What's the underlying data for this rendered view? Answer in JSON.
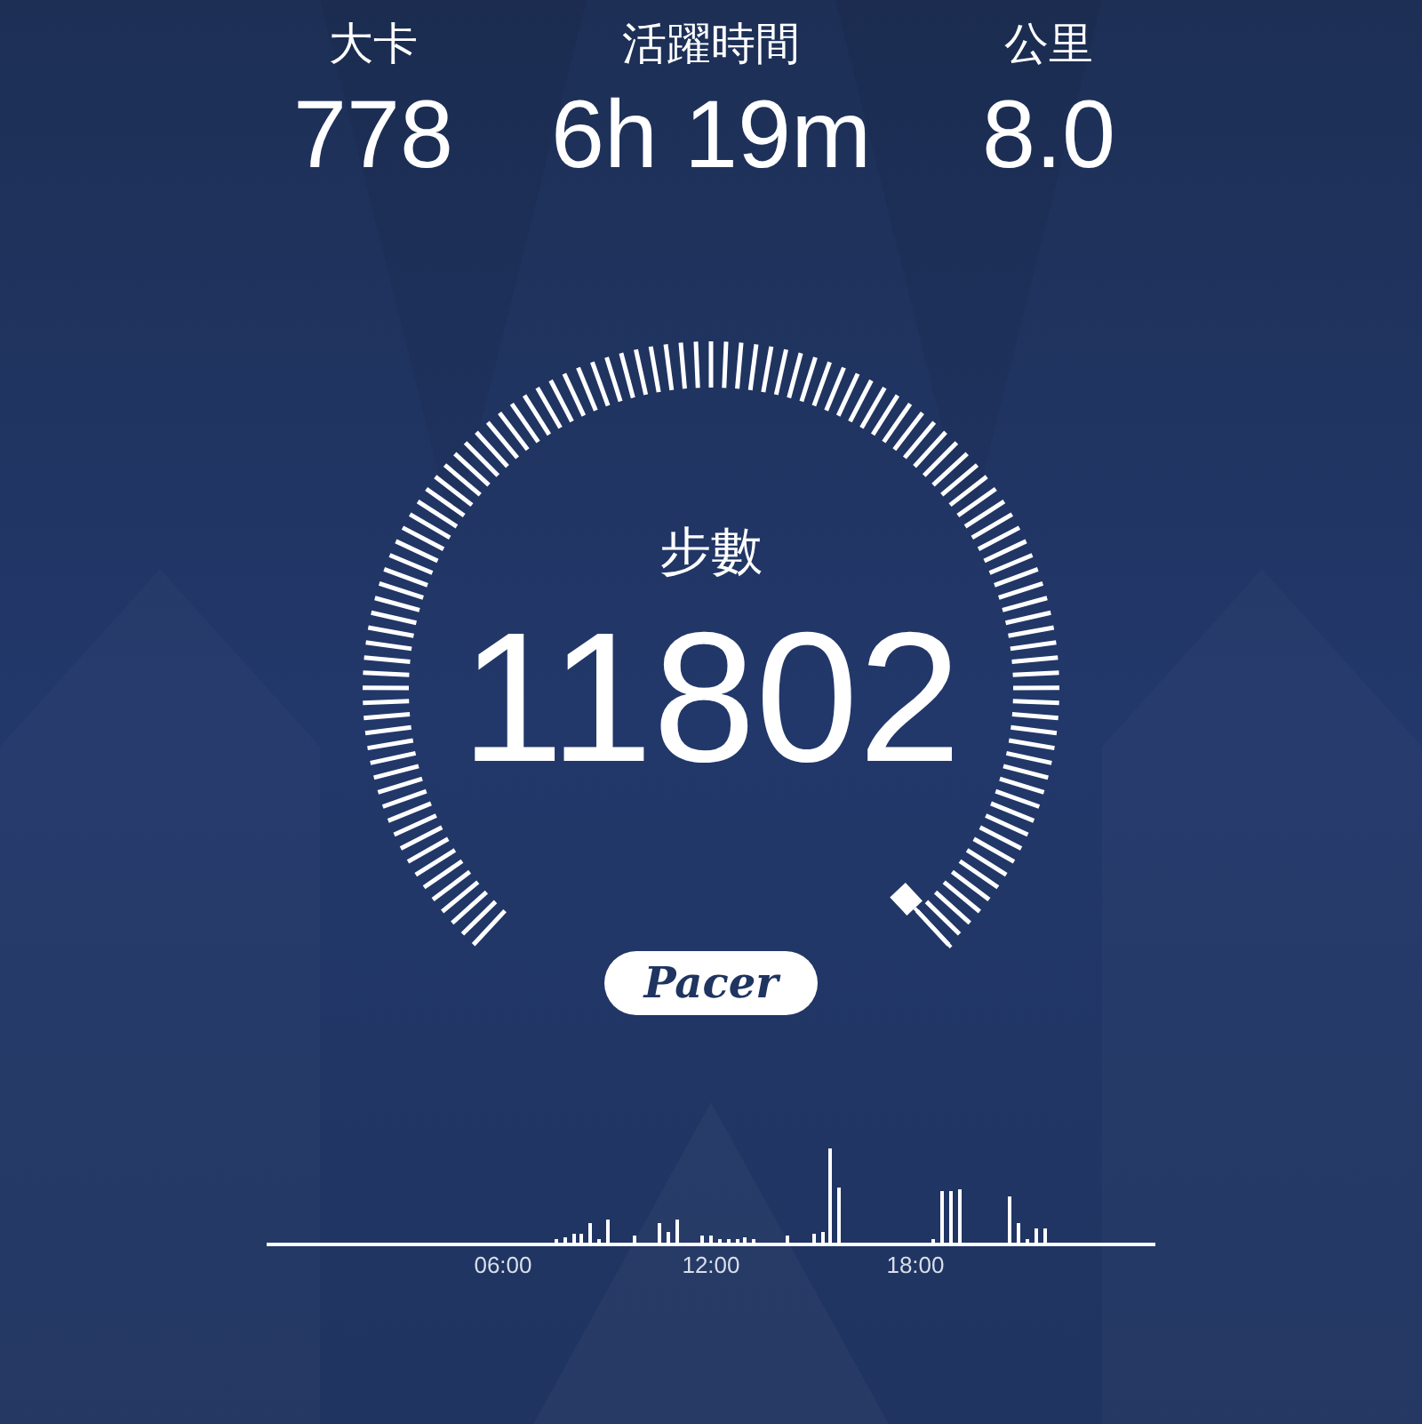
{
  "stats": [
    {
      "label": "大卡",
      "value": "778"
    },
    {
      "label": "活躍時間",
      "value": "6h 19m"
    },
    {
      "label": "公里",
      "value": "8.0"
    }
  ],
  "steps": {
    "label": "步數",
    "value": "11802"
  },
  "logo": {
    "text": "Pacer"
  },
  "hourly_chart": {
    "x_labels": [
      "06:00",
      "12:00",
      "18:00"
    ]
  }
}
